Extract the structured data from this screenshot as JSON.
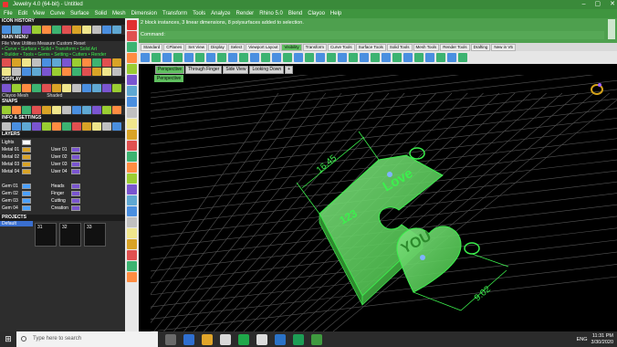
{
  "window": {
    "title": "Jewelry 4.0 (64-bit) - Untitled",
    "controls": [
      "–",
      "▢",
      "✕"
    ]
  },
  "menu": [
    "File",
    "Edit",
    "View",
    "Curve",
    "Surface",
    "Solid",
    "Mesh",
    "Dimension",
    "Transform",
    "Tools",
    "Analyze",
    "Render",
    "Rhino 5.0",
    "Blend",
    "Clayoo",
    "Help"
  ],
  "command": {
    "history": "2 block instances, 3 linear dimensions, 8 polysurfaces added to selection.",
    "prompt": "Command:"
  },
  "toolbar_tabs": [
    {
      "label": "Standard",
      "active": false
    },
    {
      "label": "CPlanes",
      "active": false
    },
    {
      "label": "Set View",
      "active": false
    },
    {
      "label": "Display",
      "active": false
    },
    {
      "label": "Select",
      "active": false
    },
    {
      "label": "Viewport Layout",
      "active": false
    },
    {
      "label": "Visibility",
      "active": true
    },
    {
      "label": "Transform",
      "active": false
    },
    {
      "label": "Curve Tools",
      "active": false
    },
    {
      "label": "Surface Tools",
      "active": false
    },
    {
      "label": "Solid Tools",
      "active": false
    },
    {
      "label": "Mesh Tools",
      "active": false
    },
    {
      "label": "Render Tools",
      "active": false
    },
    {
      "label": "Drafting",
      "active": false
    },
    {
      "label": "New in V5",
      "active": false
    }
  ],
  "left_panel": {
    "icon_history": "ICON HISTORY",
    "main_menu": "MAIN MENU",
    "main_menu_row": "File  View  Utilities  Measure  Custom     Reset",
    "module_rows": [
      "• Curve • Surface • Solid • Transform • Solid Art",
      "• Builder • Tools • Gems • Setting • Cutters • Render"
    ],
    "display": "DISPLAY",
    "display_modes": [
      "Clayoo Mesh",
      "Shaded"
    ],
    "snaps": "SNAPS",
    "info_settings": "INFO & SETTINGS",
    "layers_header": "LAYERS",
    "lights_label": "Lights",
    "layers_left": [
      "Metal 01",
      "Metal 02",
      "Metal 03",
      "Metal 04",
      "",
      "Gem 01",
      "Gem 02",
      "Gem 03",
      "Gem 04"
    ],
    "layers_right": [
      "User 01",
      "User 02",
      "User 03",
      "User 04",
      "",
      "Heads",
      "Finger",
      "Cutting",
      "Creation"
    ],
    "projects_header": "PROJECTS",
    "project_name": "Default",
    "project_thumbs": [
      "31",
      "32",
      "33"
    ]
  },
  "viewport": {
    "tabs": [
      {
        "label": "Perspective",
        "active": true
      },
      {
        "label": "Through Finger",
        "active": false
      },
      {
        "label": "Side View",
        "active": false
      },
      {
        "label": "Looking Down",
        "active": false
      },
      {
        "label": "+",
        "active": false
      }
    ],
    "label": "Perspective",
    "pendant_left_text": "Love",
    "pendant_left_text2": "123",
    "pendant_right_text": "YOU",
    "dimensions": [
      "16.45",
      "9.02"
    ]
  },
  "taskbar": {
    "search_placeholder": "Type here to search",
    "language": "ENG",
    "time": "11:31 PM",
    "date": "3/30/2020"
  },
  "colors": {
    "accent_green": "#3f953f",
    "wireframe_green": "#3cf04d",
    "selection_fill": "#66d966"
  }
}
